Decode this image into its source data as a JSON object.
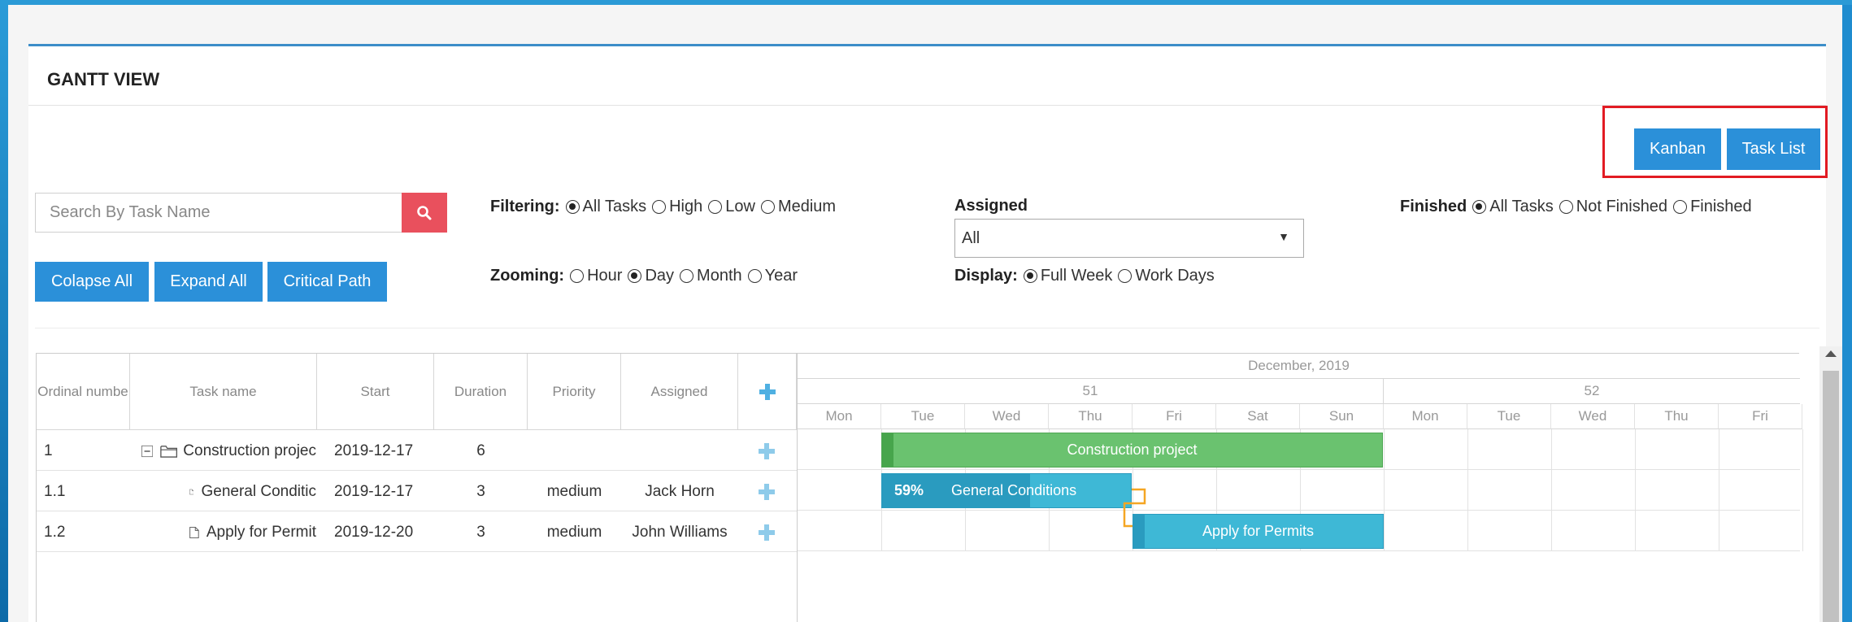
{
  "panel": {
    "title": "GANTT VIEW"
  },
  "view_buttons": {
    "kanban": "Kanban",
    "task_list": "Task List"
  },
  "search": {
    "placeholder": "Search By Task Name"
  },
  "actions": {
    "collapse_all": "Colapse All",
    "expand_all": "Expand All",
    "critical_path": "Critical Path"
  },
  "filtering": {
    "label": "Filtering:",
    "options": [
      "All Tasks",
      "High",
      "Low",
      "Medium"
    ],
    "selected": "All Tasks"
  },
  "zooming": {
    "label": "Zooming:",
    "options": [
      "Hour",
      "Day",
      "Month",
      "Year"
    ],
    "selected": "Day"
  },
  "assigned": {
    "label": "Assigned",
    "selected": "All"
  },
  "display": {
    "label": "Display:",
    "options": [
      "Full Week",
      "Work Days"
    ],
    "selected": "Full Week"
  },
  "finished": {
    "label": "Finished",
    "options": [
      "All Tasks",
      "Not Finished",
      "Finished"
    ],
    "selected": "All Tasks"
  },
  "grid": {
    "columns": [
      "Ordinal numbe",
      "Task name",
      "Start",
      "Duration",
      "Priority",
      "Assigned"
    ],
    "rows": [
      {
        "ordinal": "1",
        "name": "Construction projec",
        "start": "2019-12-17",
        "duration": "6",
        "priority": "",
        "assigned": ""
      },
      {
        "ordinal": "1.1",
        "name": "General Conditic",
        "start": "2019-12-17",
        "duration": "3",
        "priority": "medium",
        "assigned": "Jack Horn"
      },
      {
        "ordinal": "1.2",
        "name": "Apply for Permit",
        "start": "2019-12-20",
        "duration": "3",
        "priority": "medium",
        "assigned": "John Williams"
      }
    ]
  },
  "chart": {
    "month": "December, 2019",
    "weeks": [
      "51",
      "52"
    ],
    "days": [
      "Mon",
      "Tue",
      "Wed",
      "Thu",
      "Fri",
      "Sat",
      "Sun",
      "Mon",
      "Tue",
      "Wed",
      "Thu",
      "Fri"
    ],
    "bars": [
      {
        "label": "Construction project",
        "progress_label": ""
      },
      {
        "label": "General Conditions",
        "progress_label": "59%"
      },
      {
        "label": "Apply for Permits",
        "progress_label": ""
      }
    ],
    "colors": {
      "summary": "#6ac26f",
      "summary_dark": "#47a54c",
      "task": "#3eb8d6",
      "task_dark": "#2a9bbf",
      "link": "#f5a623"
    }
  }
}
